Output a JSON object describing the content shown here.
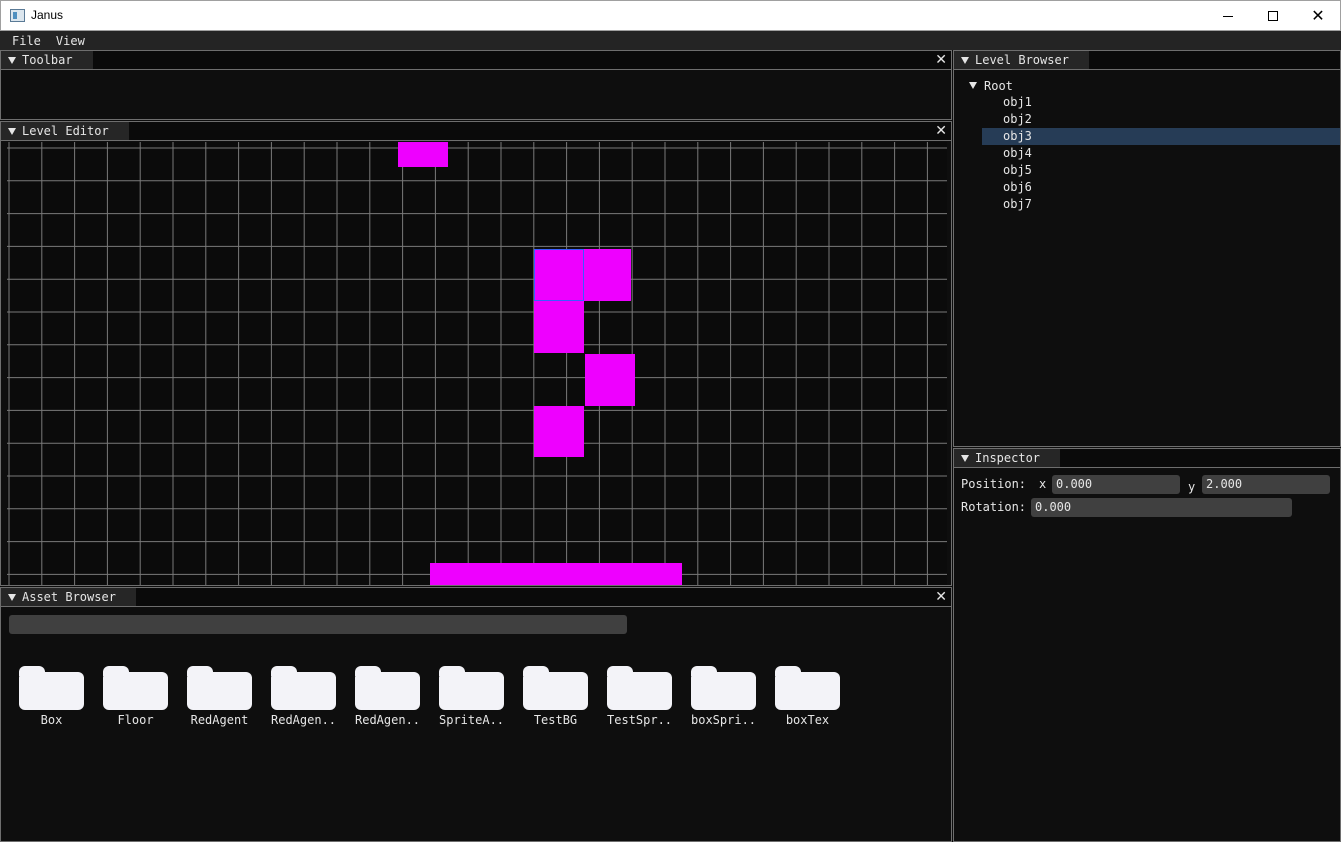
{
  "window": {
    "title": "Janus",
    "minimize": "",
    "maximize": "",
    "close": "✕"
  },
  "menu": {
    "items": [
      "File",
      "View"
    ]
  },
  "panels": {
    "toolbar": {
      "title": "Toolbar"
    },
    "level_editor": {
      "title": "Level Editor"
    },
    "asset_browser": {
      "title": "Asset Browser",
      "search_value": "",
      "assets": [
        "Box",
        "Floor",
        "RedAgent",
        "RedAgen..",
        "RedAgen..",
        "SpriteA..",
        "TestBG",
        "TestSpr..",
        "boxSpri..",
        "boxTex"
      ]
    },
    "level_browser": {
      "title": "Level Browser",
      "root": "Root",
      "items": [
        "obj1",
        "obj2",
        "obj3",
        "obj4",
        "obj5",
        "obj6",
        "obj7"
      ],
      "selected": "obj3"
    },
    "inspector": {
      "title": "Inspector",
      "position_label": "Position:",
      "x_label": "x",
      "x_value": "0.000",
      "y_label": "y",
      "y_value": "2.000",
      "rotation_label": "Rotation:",
      "rotation_value": "0.000"
    }
  },
  "colors": {
    "object": "#ee00ff",
    "grid_line": "#7a7a7a",
    "selection": "#263c56",
    "outline": "#3a5cff"
  }
}
